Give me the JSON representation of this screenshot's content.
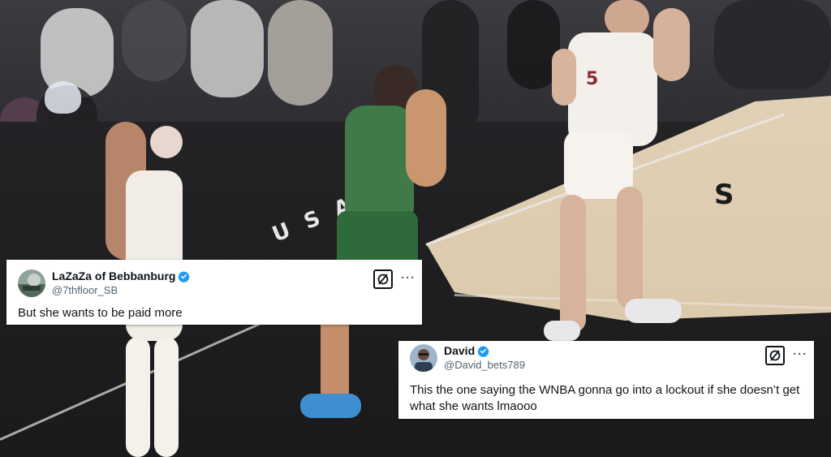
{
  "image": {
    "court_text_top": "U  S  A  N  S",
    "court_text_right": "S",
    "player_number": "5"
  },
  "tweets": [
    {
      "display_name": "LaZaZa of Bebbanburg",
      "handle": "@7thfloor_SB",
      "verified": true,
      "text": "But she wants to be paid more",
      "more_label": "···"
    },
    {
      "display_name": "David",
      "handle": "@David_bets789",
      "verified": true,
      "text": "This the one saying the WNBA gonna go into a lockout if she doesn’t get what she wants lmaooo",
      "more_label": "···"
    }
  ],
  "colors": {
    "verified_blue": "#1d9bf0",
    "card_bg": "#ffffff",
    "text_primary": "#0f1419",
    "text_secondary": "#536471"
  }
}
